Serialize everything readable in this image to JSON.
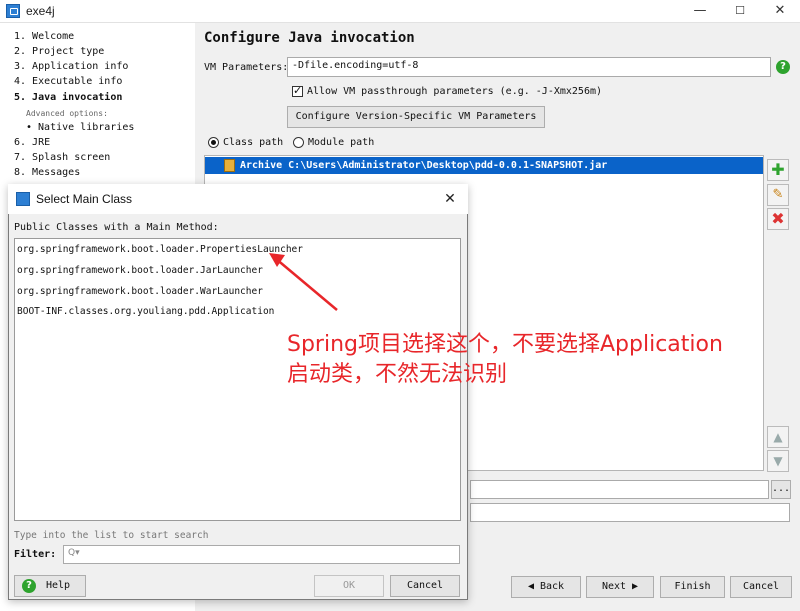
{
  "window": {
    "title": "exe4j",
    "minimize": "—",
    "maximize": "☐",
    "close": "✕"
  },
  "sidebar": {
    "items": [
      {
        "label": "1. Welcome",
        "bold": false
      },
      {
        "label": "2. Project type",
        "bold": false
      },
      {
        "label": "3. Application info",
        "bold": false
      },
      {
        "label": "4. Executable info",
        "bold": false
      },
      {
        "label": "5. Java invocation",
        "bold": true
      },
      {
        "label": "6. JRE",
        "bold": false
      },
      {
        "label": "7. Splash screen",
        "bold": false
      },
      {
        "label": "8. Messages",
        "bold": false
      }
    ],
    "advanced_label": "Advanced options:",
    "native_libraries": "• Native libraries"
  },
  "main": {
    "heading": "Configure Java invocation",
    "vm_params_label": "VM Parameters:",
    "vm_params_value": "-Dfile.encoding=utf-8",
    "allow_passthrough_label": "Allow VM passthrough parameters (e.g. -J-Xmx256m)",
    "allow_passthrough_checked": true,
    "version_specific_button": "Configure Version-Specific VM Parameters",
    "class_path_label": "Class path",
    "module_path_label": "Module path",
    "selected_path_mode": "class_path",
    "classpath_entries": [
      "Archive C:\\Users\\Administrator\\Desktop\\pdd-0.0.1-SNAPSHOT.jar"
    ],
    "help_icon": "?",
    "ellipsis": "..."
  },
  "nav_buttons": {
    "back": "◀ Back",
    "next": "Next ▶",
    "finish": "Finish",
    "cancel": "Cancel"
  },
  "dialog": {
    "title": "Select Main Class",
    "close": "✕",
    "list_label": "Public Classes with a Main Method:",
    "classes": [
      "org.springframework.boot.loader.PropertiesLauncher",
      "org.springframework.boot.loader.JarLauncher",
      "org.springframework.boot.loader.WarLauncher",
      "BOOT-INF.classes.org.youliang.pdd.Application"
    ],
    "hint": "Type into the list to start search",
    "filter_label": "Filter:",
    "filter_placeholder": "Q▾",
    "help_button": "Help",
    "ok_button": "OK",
    "cancel_button": "Cancel"
  },
  "annotation": {
    "text_line1": "Spring项目选择这个，不要选择Application",
    "text_line2": "启动类，不然无法识别",
    "color": "#e8262a"
  },
  "colors": {
    "selection": "#0a63c9",
    "accent_green": "#2ea32e",
    "delete_red": "#d33"
  }
}
